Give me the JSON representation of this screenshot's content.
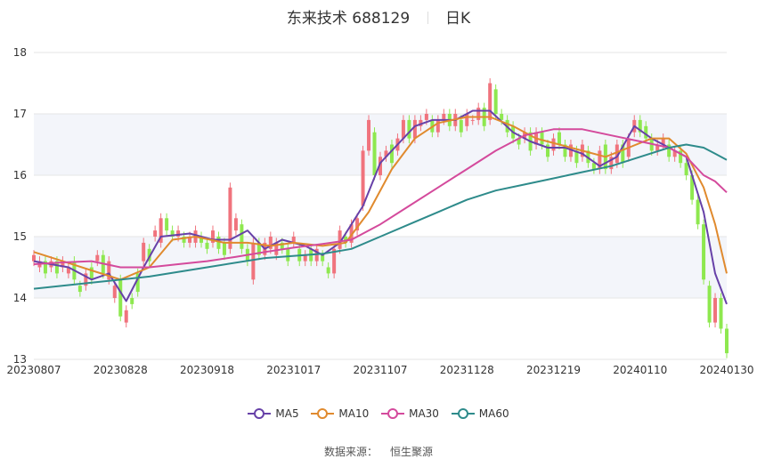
{
  "title": {
    "name": "东来技术 688129",
    "period": "日K"
  },
  "source": {
    "label": "数据来源：",
    "value": "恒生聚源"
  },
  "colors": {
    "up": "#f0737d",
    "down": "#8ee84f",
    "grid": "#e6e6e6",
    "band": "#f3f5fa",
    "axis_text": "#333333"
  },
  "legend": [
    {
      "name": "MA5",
      "color": "#6741a8"
    },
    {
      "name": "MA10",
      "color": "#e08a2e"
    },
    {
      "name": "MA30",
      "color": "#d44a9c"
    },
    {
      "name": "MA60",
      "color": "#2e8b8b"
    }
  ],
  "chart_data": {
    "type": "candlestick",
    "y_ticks": [
      13,
      14,
      15,
      16,
      17,
      18
    ],
    "ylim": [
      13,
      18
    ],
    "x_ticks": [
      "20230807",
      "20230828",
      "20230918",
      "20231017",
      "20231107",
      "20231128",
      "20231219",
      "20240110",
      "20240130"
    ],
    "x_tick_index": [
      0,
      15,
      30,
      45,
      60,
      75,
      90,
      105,
      120
    ],
    "candle_count": 121,
    "candles_approx": [
      [
        0,
        14.6,
        14.7
      ],
      [
        1,
        14.5,
        14.6
      ],
      [
        2,
        14.6,
        14.4
      ],
      [
        3,
        14.5,
        14.6
      ],
      [
        4,
        14.6,
        14.4
      ],
      [
        5,
        14.5,
        14.6
      ],
      [
        6,
        14.4,
        14.5
      ],
      [
        7,
        14.6,
        14.3
      ],
      [
        8,
        14.2,
        14.1
      ],
      [
        9,
        14.2,
        14.4
      ],
      [
        10,
        14.5,
        14.3
      ],
      [
        11,
        14.6,
        14.7
      ],
      [
        12,
        14.7,
        14.4
      ],
      [
        13,
        14.3,
        14.6
      ],
      [
        14,
        14.0,
        14.2
      ],
      [
        15,
        14.3,
        13.7
      ],
      [
        16,
        13.6,
        13.8
      ],
      [
        17,
        14.0,
        13.9
      ],
      [
        18,
        14.4,
        14.1
      ],
      [
        19,
        14.6,
        14.9
      ],
      [
        20,
        14.8,
        14.6
      ],
      [
        21,
        15.0,
        15.1
      ],
      [
        22,
        14.9,
        15.3
      ],
      [
        23,
        15.3,
        15.1
      ],
      [
        24,
        15.1,
        15.0
      ],
      [
        25,
        15.0,
        15.1
      ],
      [
        26,
        15.0,
        14.9
      ],
      [
        27,
        14.9,
        15.0
      ],
      [
        28,
        14.9,
        15.1
      ],
      [
        29,
        15.0,
        14.9
      ],
      [
        30,
        14.9,
        14.8
      ],
      [
        31,
        14.9,
        15.1
      ],
      [
        32,
        15.0,
        14.8
      ],
      [
        33,
        14.9,
        14.7
      ],
      [
        34,
        14.8,
        15.8
      ],
      [
        35,
        15.1,
        15.3
      ],
      [
        36,
        15.2,
        14.8
      ],
      [
        37,
        14.8,
        14.6
      ],
      [
        38,
        14.3,
        14.9
      ],
      [
        39,
        14.9,
        14.7
      ],
      [
        40,
        14.7,
        14.9
      ],
      [
        41,
        14.8,
        15.0
      ],
      [
        42,
        14.7,
        14.9
      ],
      [
        43,
        14.9,
        14.8
      ],
      [
        44,
        14.8,
        14.6
      ],
      [
        45,
        14.9,
        15.0
      ],
      [
        46,
        14.8,
        14.6
      ],
      [
        47,
        14.6,
        14.7
      ],
      [
        48,
        14.8,
        14.6
      ],
      [
        49,
        14.6,
        14.8
      ],
      [
        50,
        14.7,
        14.6
      ],
      [
        51,
        14.5,
        14.4
      ],
      [
        52,
        14.4,
        14.8
      ],
      [
        53,
        14.8,
        15.1
      ],
      [
        54,
        15.0,
        14.9
      ],
      [
        55,
        14.9,
        15.2
      ],
      [
        56,
        15.1,
        15.3
      ],
      [
        57,
        15.5,
        16.4
      ],
      [
        58,
        16.4,
        16.9
      ],
      [
        59,
        16.7,
        16.0
      ],
      [
        60,
        16.0,
        16.3
      ],
      [
        61,
        16.3,
        16.4
      ],
      [
        62,
        16.5,
        16.2
      ],
      [
        63,
        16.4,
        16.6
      ],
      [
        64,
        16.6,
        16.9
      ],
      [
        65,
        16.9,
        16.6
      ],
      [
        66,
        16.6,
        16.9
      ],
      [
        67,
        16.8,
        16.9
      ],
      [
        68,
        16.9,
        17.0
      ],
      [
        69,
        16.9,
        16.7
      ],
      [
        70,
        16.7,
        16.9
      ],
      [
        71,
        16.9,
        17.0
      ],
      [
        72,
        17.0,
        16.8
      ],
      [
        73,
        16.8,
        17.0
      ],
      [
        74,
        16.9,
        16.7
      ],
      [
        75,
        16.8,
        17.0
      ],
      [
        76,
        16.9,
        16.9
      ],
      [
        77,
        16.9,
        17.1
      ],
      [
        78,
        17.1,
        16.8
      ],
      [
        79,
        16.9,
        17.5
      ],
      [
        80,
        17.4,
        17.0
      ],
      [
        81,
        17.0,
        16.9
      ],
      [
        82,
        16.9,
        16.7
      ],
      [
        83,
        16.8,
        16.6
      ],
      [
        84,
        16.6,
        16.5
      ],
      [
        85,
        16.6,
        16.7
      ],
      [
        86,
        16.7,
        16.4
      ],
      [
        87,
        16.5,
        16.7
      ],
      [
        88,
        16.7,
        16.5
      ],
      [
        89,
        16.5,
        16.3
      ],
      [
        90,
        16.4,
        16.6
      ],
      [
        91,
        16.7,
        16.5
      ],
      [
        92,
        16.5,
        16.3
      ],
      [
        93,
        16.3,
        16.5
      ],
      [
        94,
        16.4,
        16.2
      ],
      [
        95,
        16.3,
        16.5
      ],
      [
        96,
        16.4,
        16.2
      ],
      [
        97,
        16.2,
        16.1
      ],
      [
        98,
        16.1,
        16.4
      ],
      [
        99,
        16.5,
        16.1
      ],
      [
        100,
        16.1,
        16.3
      ],
      [
        101,
        16.2,
        16.5
      ],
      [
        102,
        16.5,
        16.2
      ],
      [
        103,
        16.3,
        16.6
      ],
      [
        104,
        16.7,
        16.9
      ],
      [
        105,
        16.9,
        16.7
      ],
      [
        106,
        16.8,
        16.6
      ],
      [
        107,
        16.6,
        16.4
      ],
      [
        108,
        16.4,
        16.5
      ],
      [
        109,
        16.5,
        16.6
      ],
      [
        110,
        16.5,
        16.3
      ],
      [
        111,
        16.3,
        16.4
      ],
      [
        112,
        16.4,
        16.2
      ],
      [
        113,
        16.2,
        16.0
      ],
      [
        114,
        16.0,
        15.6
      ],
      [
        115,
        15.6,
        15.2
      ],
      [
        116,
        15.2,
        14.3
      ],
      [
        117,
        14.2,
        13.6
      ],
      [
        118,
        13.6,
        14.0
      ],
      [
        119,
        14.0,
        13.5
      ],
      [
        120,
        13.5,
        13.1
      ]
    ],
    "series": [
      {
        "name": "MA5",
        "points": [
          [
            0,
            14.6
          ],
          [
            6,
            14.5
          ],
          [
            10,
            14.3
          ],
          [
            13,
            14.4
          ],
          [
            16,
            13.95
          ],
          [
            19,
            14.5
          ],
          [
            22,
            15.0
          ],
          [
            27,
            15.05
          ],
          [
            31,
            14.95
          ],
          [
            34,
            14.95
          ],
          [
            37,
            15.1
          ],
          [
            40,
            14.8
          ],
          [
            43,
            14.95
          ],
          [
            47,
            14.85
          ],
          [
            50,
            14.7
          ],
          [
            53,
            14.9
          ],
          [
            57,
            15.5
          ],
          [
            60,
            16.2
          ],
          [
            63,
            16.5
          ],
          [
            66,
            16.8
          ],
          [
            69,
            16.9
          ],
          [
            73,
            16.9
          ],
          [
            76,
            17.05
          ],
          [
            79,
            17.05
          ],
          [
            83,
            16.7
          ],
          [
            86,
            16.55
          ],
          [
            89,
            16.45
          ],
          [
            92,
            16.45
          ],
          [
            95,
            16.35
          ],
          [
            98,
            16.15
          ],
          [
            101,
            16.3
          ],
          [
            104,
            16.8
          ],
          [
            107,
            16.6
          ],
          [
            110,
            16.45
          ],
          [
            113,
            16.3
          ],
          [
            116,
            15.4
          ],
          [
            118,
            14.4
          ],
          [
            120,
            13.9
          ]
        ]
      },
      {
        "name": "MA10",
        "points": [
          [
            0,
            14.75
          ],
          [
            5,
            14.6
          ],
          [
            10,
            14.45
          ],
          [
            15,
            14.3
          ],
          [
            20,
            14.5
          ],
          [
            24,
            14.95
          ],
          [
            28,
            15.0
          ],
          [
            33,
            14.9
          ],
          [
            37,
            14.9
          ],
          [
            41,
            14.85
          ],
          [
            45,
            14.9
          ],
          [
            50,
            14.85
          ],
          [
            54,
            14.9
          ],
          [
            58,
            15.4
          ],
          [
            62,
            16.1
          ],
          [
            66,
            16.6
          ],
          [
            70,
            16.85
          ],
          [
            75,
            16.95
          ],
          [
            79,
            16.95
          ],
          [
            83,
            16.8
          ],
          [
            87,
            16.6
          ],
          [
            91,
            16.5
          ],
          [
            95,
            16.4
          ],
          [
            99,
            16.3
          ],
          [
            103,
            16.45
          ],
          [
            107,
            16.6
          ],
          [
            110,
            16.6
          ],
          [
            113,
            16.35
          ],
          [
            116,
            15.8
          ],
          [
            118,
            15.2
          ],
          [
            120,
            14.4
          ]
        ]
      },
      {
        "name": "MA30",
        "points": [
          [
            0,
            14.55
          ],
          [
            5,
            14.58
          ],
          [
            10,
            14.6
          ],
          [
            15,
            14.5
          ],
          [
            20,
            14.5
          ],
          [
            25,
            14.55
          ],
          [
            30,
            14.6
          ],
          [
            35,
            14.67
          ],
          [
            40,
            14.75
          ],
          [
            45,
            14.82
          ],
          [
            50,
            14.88
          ],
          [
            55,
            14.95
          ],
          [
            60,
            15.2
          ],
          [
            65,
            15.5
          ],
          [
            70,
            15.8
          ],
          [
            75,
            16.1
          ],
          [
            80,
            16.4
          ],
          [
            85,
            16.65
          ],
          [
            90,
            16.75
          ],
          [
            95,
            16.75
          ],
          [
            100,
            16.65
          ],
          [
            105,
            16.55
          ],
          [
            110,
            16.45
          ],
          [
            113,
            16.3
          ],
          [
            116,
            16.0
          ],
          [
            118,
            15.9
          ],
          [
            120,
            15.72
          ]
        ]
      },
      {
        "name": "MA60",
        "points": [
          [
            0,
            14.15
          ],
          [
            10,
            14.25
          ],
          [
            20,
            14.35
          ],
          [
            30,
            14.5
          ],
          [
            40,
            14.65
          ],
          [
            50,
            14.72
          ],
          [
            55,
            14.8
          ],
          [
            60,
            15.0
          ],
          [
            65,
            15.2
          ],
          [
            70,
            15.4
          ],
          [
            75,
            15.6
          ],
          [
            80,
            15.75
          ],
          [
            85,
            15.85
          ],
          [
            90,
            15.95
          ],
          [
            95,
            16.05
          ],
          [
            100,
            16.15
          ],
          [
            105,
            16.3
          ],
          [
            110,
            16.45
          ],
          [
            113,
            16.5
          ],
          [
            116,
            16.45
          ],
          [
            118,
            16.35
          ],
          [
            120,
            16.25
          ]
        ]
      }
    ]
  }
}
